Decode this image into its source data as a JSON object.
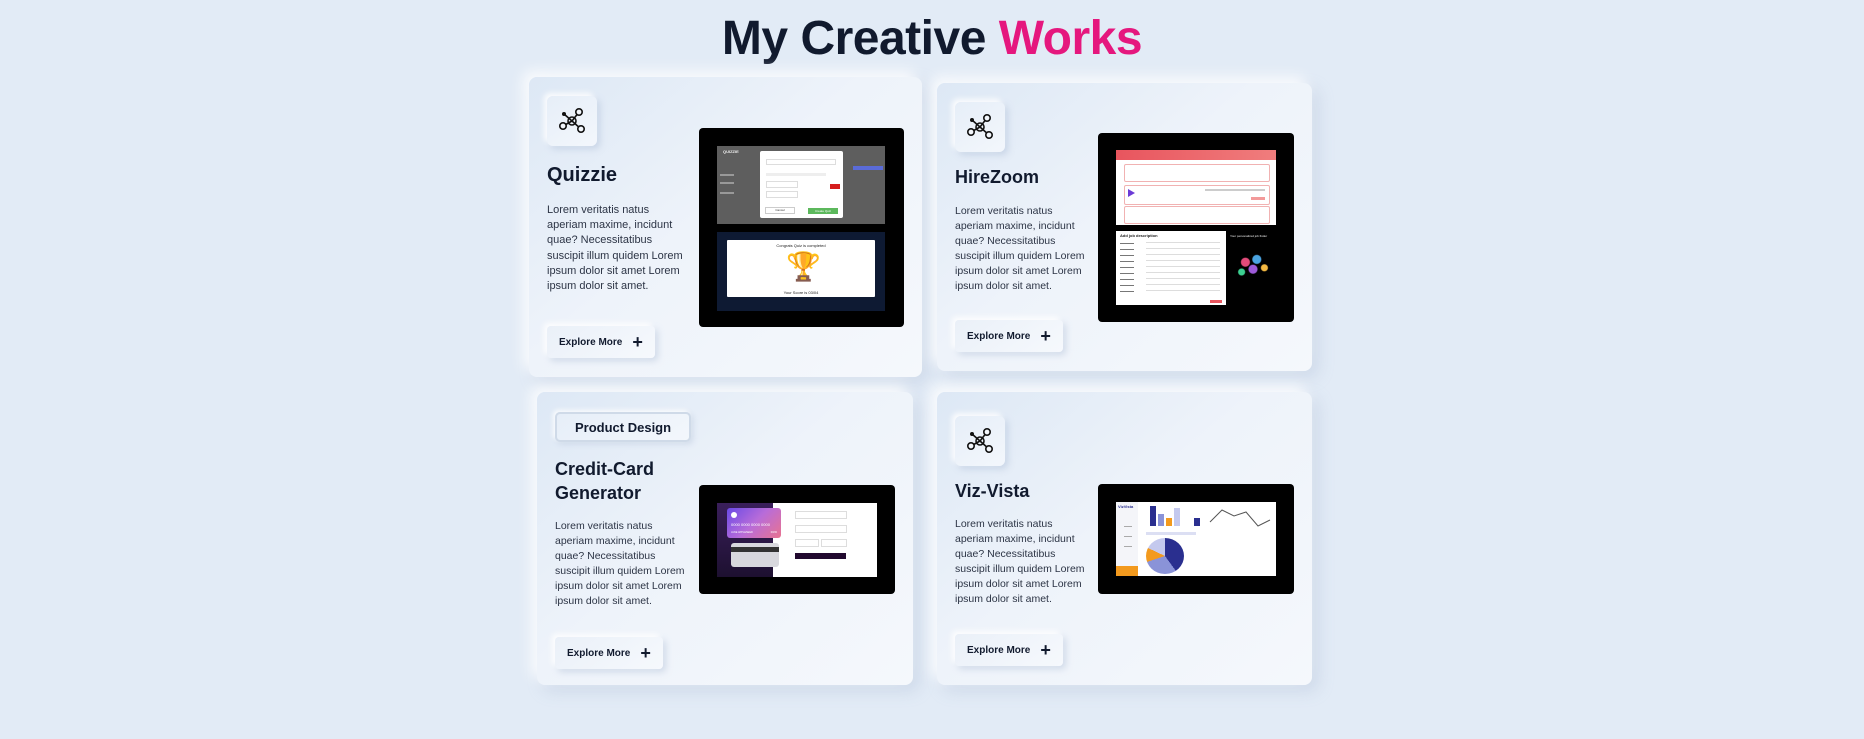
{
  "header": {
    "title_main": "My Creative",
    "title_accent": "Works"
  },
  "colors": {
    "accent": "#e5177e",
    "background": "#e2ebf6",
    "text": "#111a2e"
  },
  "projects": [
    {
      "title": "Quizzie",
      "description": "Lorem veritatis natus aperiam maxime, incidunt quae? Necessitatibus suscipit illum quidem Lorem ipsum dolor sit amet Lorem ipsum dolor sit amet.",
      "button_label": "Explore More",
      "icon": "network-icon",
      "preview": {
        "brand": "QUIZZIE",
        "modal_cancel": "Cancel",
        "modal_confirm": "Create Quiz",
        "congrats_text": "Congrats Quiz is completed",
        "score_text": "Your Score is 03/04"
      }
    },
    {
      "title": "HireZoom",
      "description": "Lorem veritatis natus aperiam maxime, incidunt quae? Necessitatibus suscipit illum quidem Lorem ipsum dolor sit amet Lorem ipsum dolor sit amet.",
      "button_label": "Explore More",
      "icon": "network-icon",
      "preview": {
        "form_title": "Add job description",
        "side_text": "Your personalized job finder"
      }
    },
    {
      "title": "Credit-Card Generator",
      "tag": "Product Design",
      "description": "Lorem veritatis natus aperiam maxime, incidunt quae? Necessitatibus suscipit illum quidem Lorem ipsum dolor sit amet Lorem ipsum dolor sit amet.",
      "button_label": "Explore More",
      "icon": "network-icon",
      "preview": {
        "card_number": "0000 0000 0000 0000",
        "card_holder": "JANE APPLESEED",
        "card_expiry": "00/00"
      }
    },
    {
      "title": "Viz-Vista",
      "description": "Lorem veritatis natus aperiam maxime, incidunt quae? Necessitatibus suscipit illum quidem Lorem ipsum dolor sit amet Lorem ipsum dolor sit amet.",
      "button_label": "Explore More",
      "icon": "network-icon",
      "preview": {
        "brand": "VizVista"
      }
    }
  ]
}
